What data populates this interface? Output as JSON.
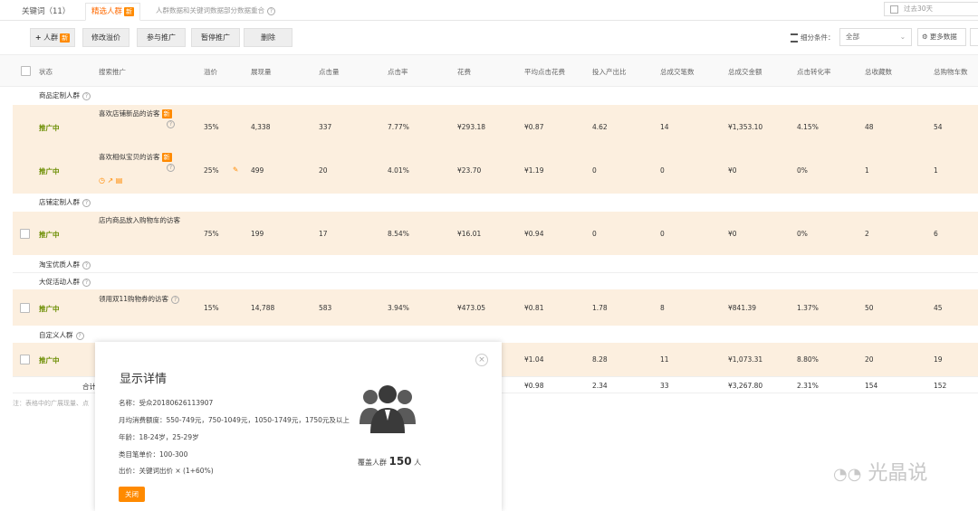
{
  "tabs": [
    {
      "label": "关键词（11）"
    },
    {
      "label": "精选人群",
      "badge": "新"
    }
  ],
  "tab_note": "人群数据和关键词数据部分数据重合",
  "date_range": "过去30天",
  "toolbar": {
    "add_crowd": "人群",
    "add_badge": "新",
    "modify_bid": "修改溢价",
    "join_promo": "参与推广",
    "pause_promo": "暂停推广",
    "delete": "删除",
    "filter_label": "细分条件：",
    "filter_value": "全部",
    "more_data": "更多数据"
  },
  "headers": [
    "状态",
    "搜索推广",
    "溢价",
    "展现量",
    "点击量",
    "点击率",
    "花费",
    "平均点击花费",
    "投入产出比",
    "总成交笔数",
    "总成交金额",
    "点击转化率",
    "总收藏数",
    "总购物车数"
  ],
  "groups": {
    "g1": "商品定制人群",
    "g2": "店铺定制人群",
    "g3": "淘宝优质人群",
    "g4": "大促活动人群",
    "g5": "自定义人群"
  },
  "rows": [
    {
      "status": "推广中",
      "name": "喜欢店铺新品的访客",
      "badge": "新",
      "premium": "35%",
      "impressions": "4,338",
      "clicks": "337",
      "ctr": "7.77%",
      "cost": "¥293.18",
      "cpc": "¥0.87",
      "roi": "4.62",
      "orders": "14",
      "gmv": "¥1,353.10",
      "cvr": "4.15%",
      "favs": "48",
      "carts": "54"
    },
    {
      "status": "推广中",
      "name": "喜欢相似宝贝的访客",
      "badge": "新",
      "premium": "25%",
      "impressions": "499",
      "clicks": "20",
      "ctr": "4.01%",
      "cost": "¥23.70",
      "cpc": "¥1.19",
      "roi": "0",
      "orders": "0",
      "gmv": "¥0",
      "cvr": "0%",
      "favs": "1",
      "carts": "1"
    },
    {
      "status": "推广中",
      "name": "店内商品放入购物车的访客",
      "premium": "75%",
      "impressions": "199",
      "clicks": "17",
      "ctr": "8.54%",
      "cost": "¥16.01",
      "cpc": "¥0.94",
      "roi": "0",
      "orders": "0",
      "gmv": "¥0",
      "cvr": "0%",
      "favs": "2",
      "carts": "6"
    },
    {
      "status": "推广中",
      "name": "领用双11购物券的访客",
      "premium": "15%",
      "impressions": "14,788",
      "clicks": "583",
      "ctr": "3.94%",
      "cost": "¥473.05",
      "cpc": "¥0.81",
      "roi": "1.78",
      "orders": "8",
      "gmv": "¥841.39",
      "cvr": "1.37%",
      "favs": "50",
      "carts": "45"
    },
    {
      "status": "推广中",
      "cpc": "¥1.04",
      "roi": "8.28",
      "orders": "11",
      "gmv": "¥1,073.31",
      "cvr": "8.80%",
      "favs": "20",
      "carts": "19"
    }
  ],
  "total": {
    "label": "合计",
    "cpc": "¥0.98",
    "roi": "2.34",
    "orders": "33",
    "gmv": "¥3,267.80",
    "cvr": "2.31%",
    "favs": "154",
    "carts": "152"
  },
  "foot_note": "注：表格中的广展现量、点",
  "popup": {
    "title": "显示详情",
    "lines": [
      "名称：受众20180626113907",
      "月均消费额度：550-749元，750-1049元，1050-1749元，1750元及以上",
      "年龄：18-24岁，25-29岁",
      "类目笔单价：100-300",
      "出价：关键词出价 × (1+60%)"
    ],
    "cover_label": "覆盖人群",
    "cover_value": "150",
    "cover_unit": "人",
    "close_label": "关闭"
  },
  "watermark": "光晶说",
  "colors": {
    "accent": "#ff8a00",
    "row_bg": "#fcefdf",
    "status": "#6a8d00"
  }
}
